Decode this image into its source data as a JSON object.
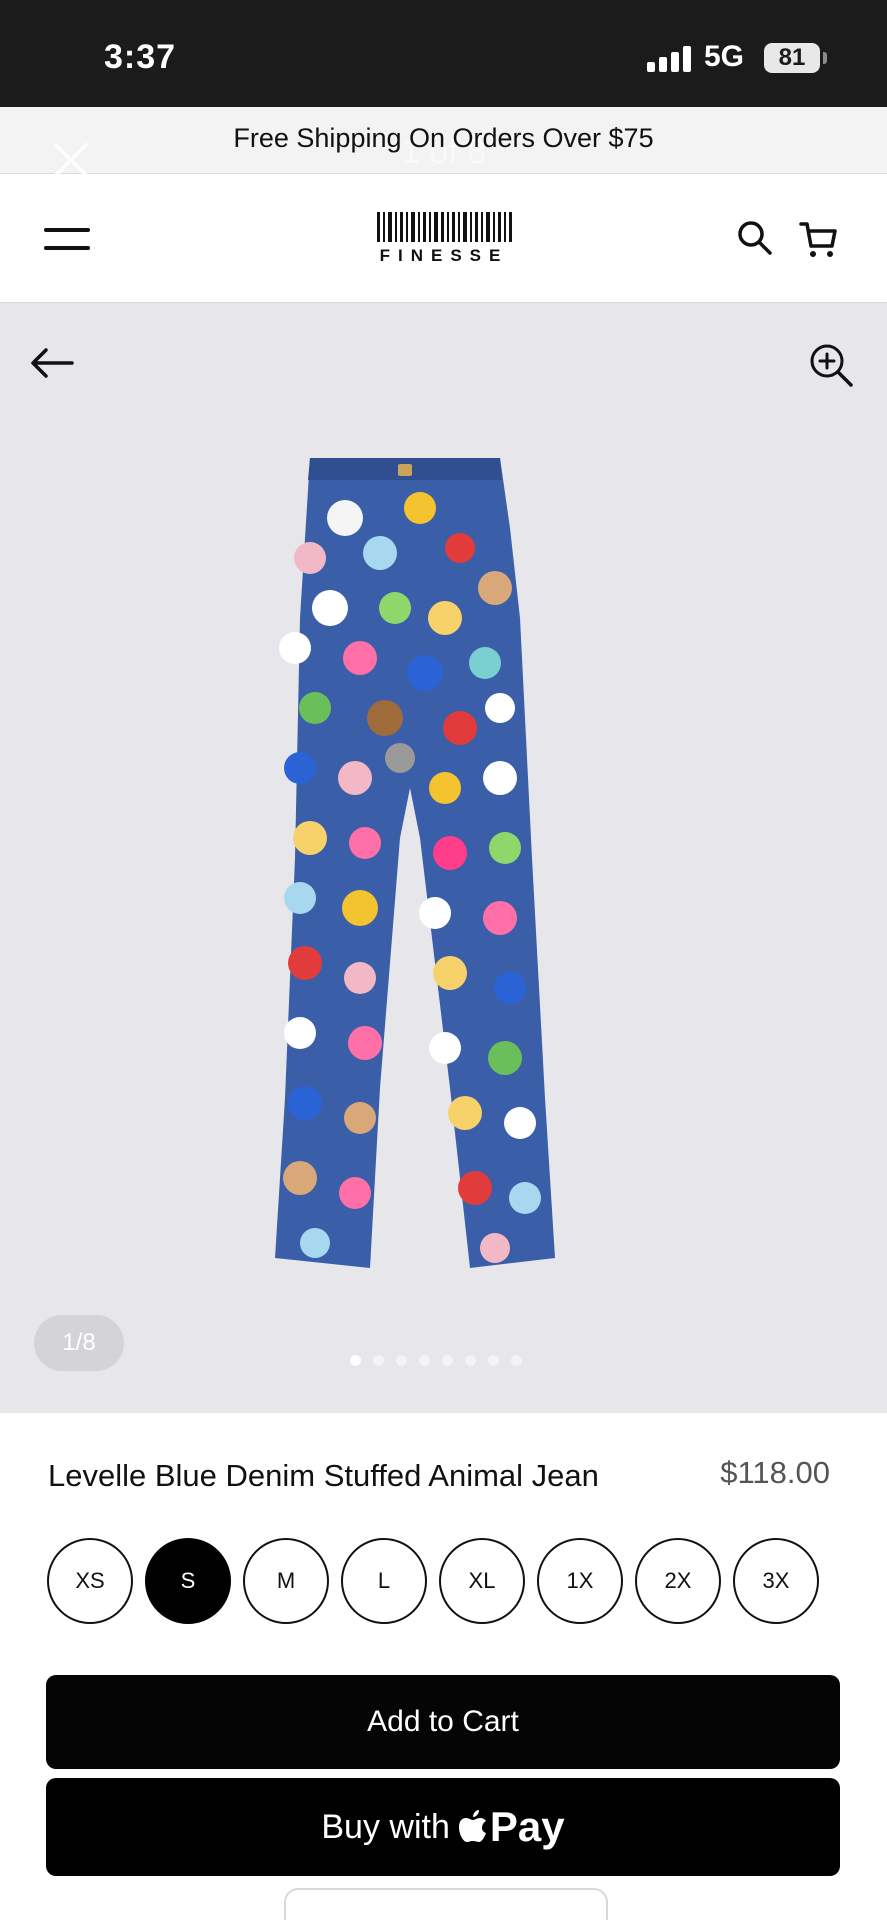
{
  "status_bar": {
    "time": "3:37",
    "network": "5G",
    "battery": "81"
  },
  "promo": {
    "text": "Free Shipping On Orders Over $75",
    "overlay_counter": "1 of 8"
  },
  "header": {
    "logo_text": "FINESSE"
  },
  "gallery": {
    "counter": "1/8",
    "total_images": 8,
    "active_index": 1,
    "image_alt": "Blue denim jeans covered in stuffed animal plushies"
  },
  "product": {
    "title": "Levelle Blue Denim Stuffed Animal Jean",
    "price": "$118.00",
    "sizes": [
      "XS",
      "S",
      "M",
      "L",
      "XL",
      "1X",
      "2X",
      "3X"
    ],
    "selected_size": "S"
  },
  "actions": {
    "add_to_cart": "Add to Cart",
    "buy_with": "Buy with",
    "pay": "Pay"
  },
  "colors": {
    "accent": "#000000",
    "gallery_bg": "#e7e7eb",
    "denim": "#3b5ea8"
  }
}
